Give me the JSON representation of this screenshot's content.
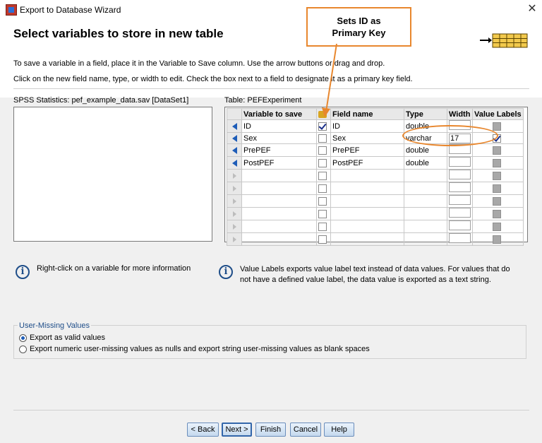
{
  "window": {
    "title": "Export to Database Wizard",
    "close_glyph": "✕"
  },
  "header": {
    "title": "Select variables to store in new table",
    "instruction_1": "To save a variable in a field, place it in the Variable to Save column. Use the arrow buttons or drag and drop.",
    "instruction_2": "Click on the new field name, type, or width to edit. Check the box next to a field to designate it as a primary key field."
  },
  "left_panel": {
    "label": "SPSS Statistics:  pef_example_data.sav [DataSet1]",
    "items": []
  },
  "table_panel": {
    "label": "Table: PEFExperiment",
    "columns": [
      "Variable to save",
      "Field name",
      "Type",
      "Width",
      "Value Labels"
    ],
    "rows": [
      {
        "variable": "ID",
        "primary_key": true,
        "field": "ID",
        "type": "double",
        "width": "",
        "value_labels": false,
        "value_labels_enabled": false
      },
      {
        "variable": "Sex",
        "primary_key": false,
        "field": "Sex",
        "type": "varchar",
        "width": "17",
        "value_labels": true,
        "value_labels_enabled": true
      },
      {
        "variable": "PrePEF",
        "primary_key": false,
        "field": "PrePEF",
        "type": "double",
        "width": "",
        "value_labels": false,
        "value_labels_enabled": false
      },
      {
        "variable": "PostPEF",
        "primary_key": false,
        "field": "PostPEF",
        "type": "double",
        "width": "",
        "value_labels": false,
        "value_labels_enabled": false
      },
      {
        "variable": "",
        "primary_key": false,
        "field": "",
        "type": "",
        "width": "",
        "value_labels": false,
        "value_labels_enabled": false
      },
      {
        "variable": "",
        "primary_key": false,
        "field": "",
        "type": "",
        "width": "",
        "value_labels": false,
        "value_labels_enabled": false
      },
      {
        "variable": "",
        "primary_key": false,
        "field": "",
        "type": "",
        "width": "",
        "value_labels": false,
        "value_labels_enabled": false
      },
      {
        "variable": "",
        "primary_key": false,
        "field": "",
        "type": "",
        "width": "",
        "value_labels": false,
        "value_labels_enabled": false
      },
      {
        "variable": "",
        "primary_key": false,
        "field": "",
        "type": "",
        "width": "",
        "value_labels": false,
        "value_labels_enabled": false
      },
      {
        "variable": "",
        "primary_key": false,
        "field": "",
        "type": "",
        "width": "",
        "value_labels": false,
        "value_labels_enabled": false
      }
    ]
  },
  "info": {
    "left": "Right-click on a variable for more information",
    "right": "Value Labels exports value label text instead of data values. For values that do not have a defined value label, the data value is exported as a text string.",
    "icon_glyph": "i"
  },
  "user_missing": {
    "title": "User-Missing Values",
    "options": [
      {
        "label": "Export as valid values",
        "selected": true
      },
      {
        "label": "Export numeric user-missing values as nulls and export string user-missing values as blank spaces",
        "selected": false
      }
    ]
  },
  "buttons": {
    "back": "< Back",
    "next": "Next >",
    "finish": "Finish",
    "cancel": "Cancel",
    "help": "Help"
  },
  "annotation": {
    "callout_line1": "Sets ID as",
    "callout_line2": "Primary Key",
    "color": "#e8872e"
  },
  "icons": {
    "app": "spss-app-icon",
    "database": "database-table-icon",
    "info": "info-icon"
  }
}
